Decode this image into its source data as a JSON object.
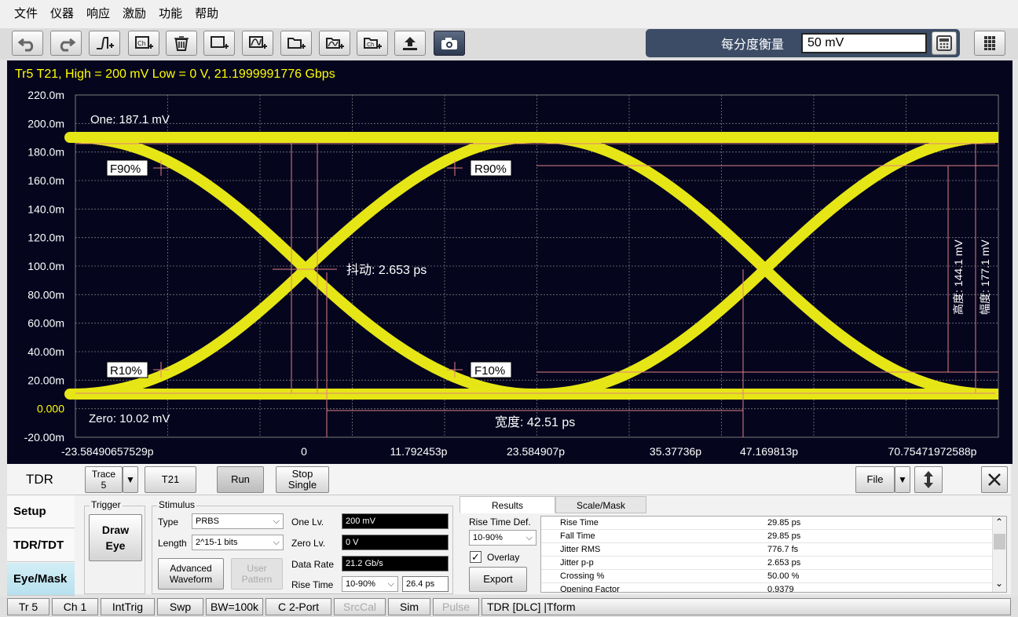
{
  "menu": [
    "文件",
    "仪器",
    "响应",
    "激励",
    "功能",
    "帮助"
  ],
  "toolbar": {
    "buttons": [
      "undo-icon",
      "redo-icon",
      "step-response-icon",
      "add-channel-icon",
      "delete-icon",
      "add-window-icon",
      "add-trace-window-icon",
      "add-folder-icon",
      "add-folder-trace-icon",
      "add-channel-folder-icon",
      "upload-icon",
      "camera-icon"
    ],
    "scale_label": "每分度衡量",
    "scale_value": "50 mV"
  },
  "plot": {
    "header": "Tr5 T21, High = 200 mV Low = 0 V, 21.1999991776 Gbps",
    "y_ticks": [
      "220.0m",
      "200.0m",
      "180.0m",
      "160.0m",
      "140.0m",
      "120.0m",
      "100.0m",
      "80.00m",
      "60.00m",
      "40.00m",
      "20.00m",
      "0.000",
      "-20.00m"
    ],
    "x_ticks": [
      "-23.58490657529p",
      "0",
      "11.792453p",
      "23.584907p",
      "35.37736p",
      "47.169813p",
      "70.75471972588p"
    ],
    "annotations": {
      "one": "One: 187.1 mV",
      "zero": "Zero: 10.02 mV",
      "f90": "F90%",
      "r90": "R90%",
      "r10": "R10%",
      "f10": "F10%",
      "jitter": "抖动: 2.653 ps",
      "width": "宽度: 42.51 ps",
      "height": "高度: 144.1 mV",
      "amplitude": "幅度: 177.1 mV"
    },
    "colors": {
      "background": "#05051e",
      "trace": "#e6e616",
      "marker": "#e08080",
      "header": "#ffff00",
      "grid": "#7a7a7a"
    }
  },
  "panel": {
    "title": "TDR",
    "trace_label": "Trace",
    "trace_value": "5",
    "t21": "T21",
    "run": "Run",
    "stop": "Stop",
    "single": "Single",
    "file": "File",
    "nav": [
      "Setup",
      "TDR/TDT",
      "Eye/Mask"
    ],
    "trigger": {
      "title": "Trigger",
      "draw_eye_1": "Draw",
      "draw_eye_2": "Eye"
    },
    "stimulus": {
      "title": "Stimulus",
      "type_label": "Type",
      "type_value": "PRBS",
      "length_label": "Length",
      "length_value": "2^15-1 bits",
      "advanced_1": "Advanced",
      "advanced_2": "Waveform",
      "user_1": "User",
      "user_2": "Pattern",
      "one_lv_label": "One Lv.",
      "one_lv_value": "200 mV",
      "zero_lv_label": "Zero Lv.",
      "zero_lv_value": "0 V",
      "data_rate_label": "Data Rate",
      "data_rate_value": "21.2 Gb/s",
      "rise_time_label": "Rise Time",
      "rise_time_def": "10-90%",
      "rise_time_value": "26.4 ps"
    },
    "results": {
      "tab_results": "Results",
      "tab_scale": "Scale/Mask",
      "rise_def_label": "Rise Time Def.",
      "rise_def_value": "10-90%",
      "overlay_label": "Overlay",
      "overlay_checked": true,
      "export": "Export",
      "rows": [
        {
          "name": "Rise Time",
          "value": "29.85 ps"
        },
        {
          "name": "Fall Time",
          "value": "29.85 ps"
        },
        {
          "name": "Jitter RMS",
          "value": "776.7 fs"
        },
        {
          "name": "Jitter p-p",
          "value": "2.653 ps"
        },
        {
          "name": "Crossing %",
          "value": "50.00 %"
        },
        {
          "name": "Opening Factor",
          "value": "0.9379"
        }
      ]
    }
  },
  "statusbar": [
    "Tr 5",
    "Ch 1",
    "IntTrig",
    "Swp",
    "BW=100k",
    "C  2-Port",
    "SrcCal",
    "Sim",
    "Pulse",
    "TDR [DLC] |Tform"
  ]
}
